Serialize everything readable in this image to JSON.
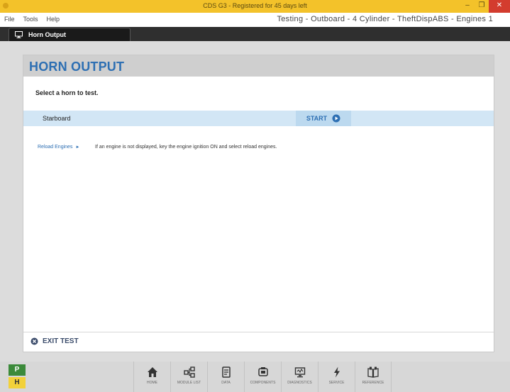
{
  "window": {
    "title": "CDS G3 - Registered for 45 days left",
    "controls": [
      "–",
      "❐",
      "✕"
    ]
  },
  "menu": {
    "items": [
      "File",
      "Tools",
      "Help"
    ],
    "context": "Testing - Outboard - 4 Cylinder - TheftDispABS - Engines 1"
  },
  "tab": {
    "label": "Horn Output",
    "icon": "monitor-icon"
  },
  "panel": {
    "title": "HORN OUTPUT",
    "prompt": "Select a horn to test.",
    "rows": [
      {
        "label": "Starboard",
        "action": "START"
      }
    ],
    "reload": {
      "label": "Reload Engines",
      "hint": "If an engine is not displayed, key the engine ignition ON and select reload engines."
    },
    "exit_label": "EXIT TEST"
  },
  "status": {
    "p": "P",
    "h": "H"
  },
  "dock": {
    "items": [
      {
        "label": "Home",
        "icon": "home-icon"
      },
      {
        "label": "Module List",
        "icon": "module-list-icon"
      },
      {
        "label": "Data",
        "icon": "data-icon"
      },
      {
        "label": "Components",
        "icon": "components-icon"
      },
      {
        "label": "Diagnostics",
        "icon": "diagnostics-icon"
      },
      {
        "label": "Service",
        "icon": "lightning-icon"
      },
      {
        "label": "Reference",
        "icon": "book-icon"
      }
    ]
  },
  "colors": {
    "titlebar": "#f3c22a",
    "accent": "#2d6fb3",
    "row_bg": "#d2e6f5",
    "p_badge": "#3b8a3a",
    "h_badge": "#f2d13a"
  }
}
